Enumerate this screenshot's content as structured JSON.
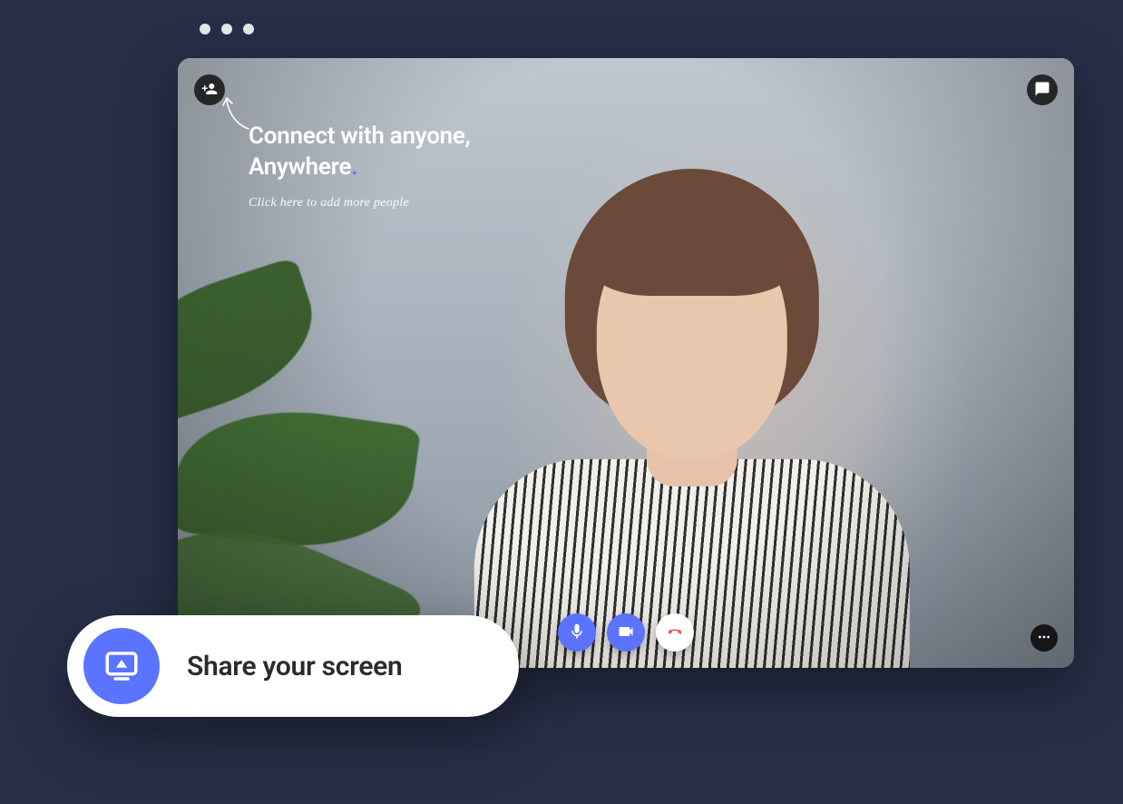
{
  "overlay": {
    "title_line1": "Connect with anyone,",
    "title_line2": "Anywhere",
    "accent": ".",
    "subtitle": "Click here to add more people"
  },
  "icons": {
    "add_people": "person-add-icon",
    "chat": "chat-icon",
    "more": "more-horizontal-icon",
    "mic": "microphone-icon",
    "camera": "video-camera-icon",
    "hangup": "phone-hangup-icon",
    "screenshare": "screenshare-icon"
  },
  "toast": {
    "share_label": "Share your screen"
  },
  "colors": {
    "accent_blue": "#5a74ff",
    "hangup_red": "#ff4d4d",
    "page_bg": "#272e47"
  }
}
